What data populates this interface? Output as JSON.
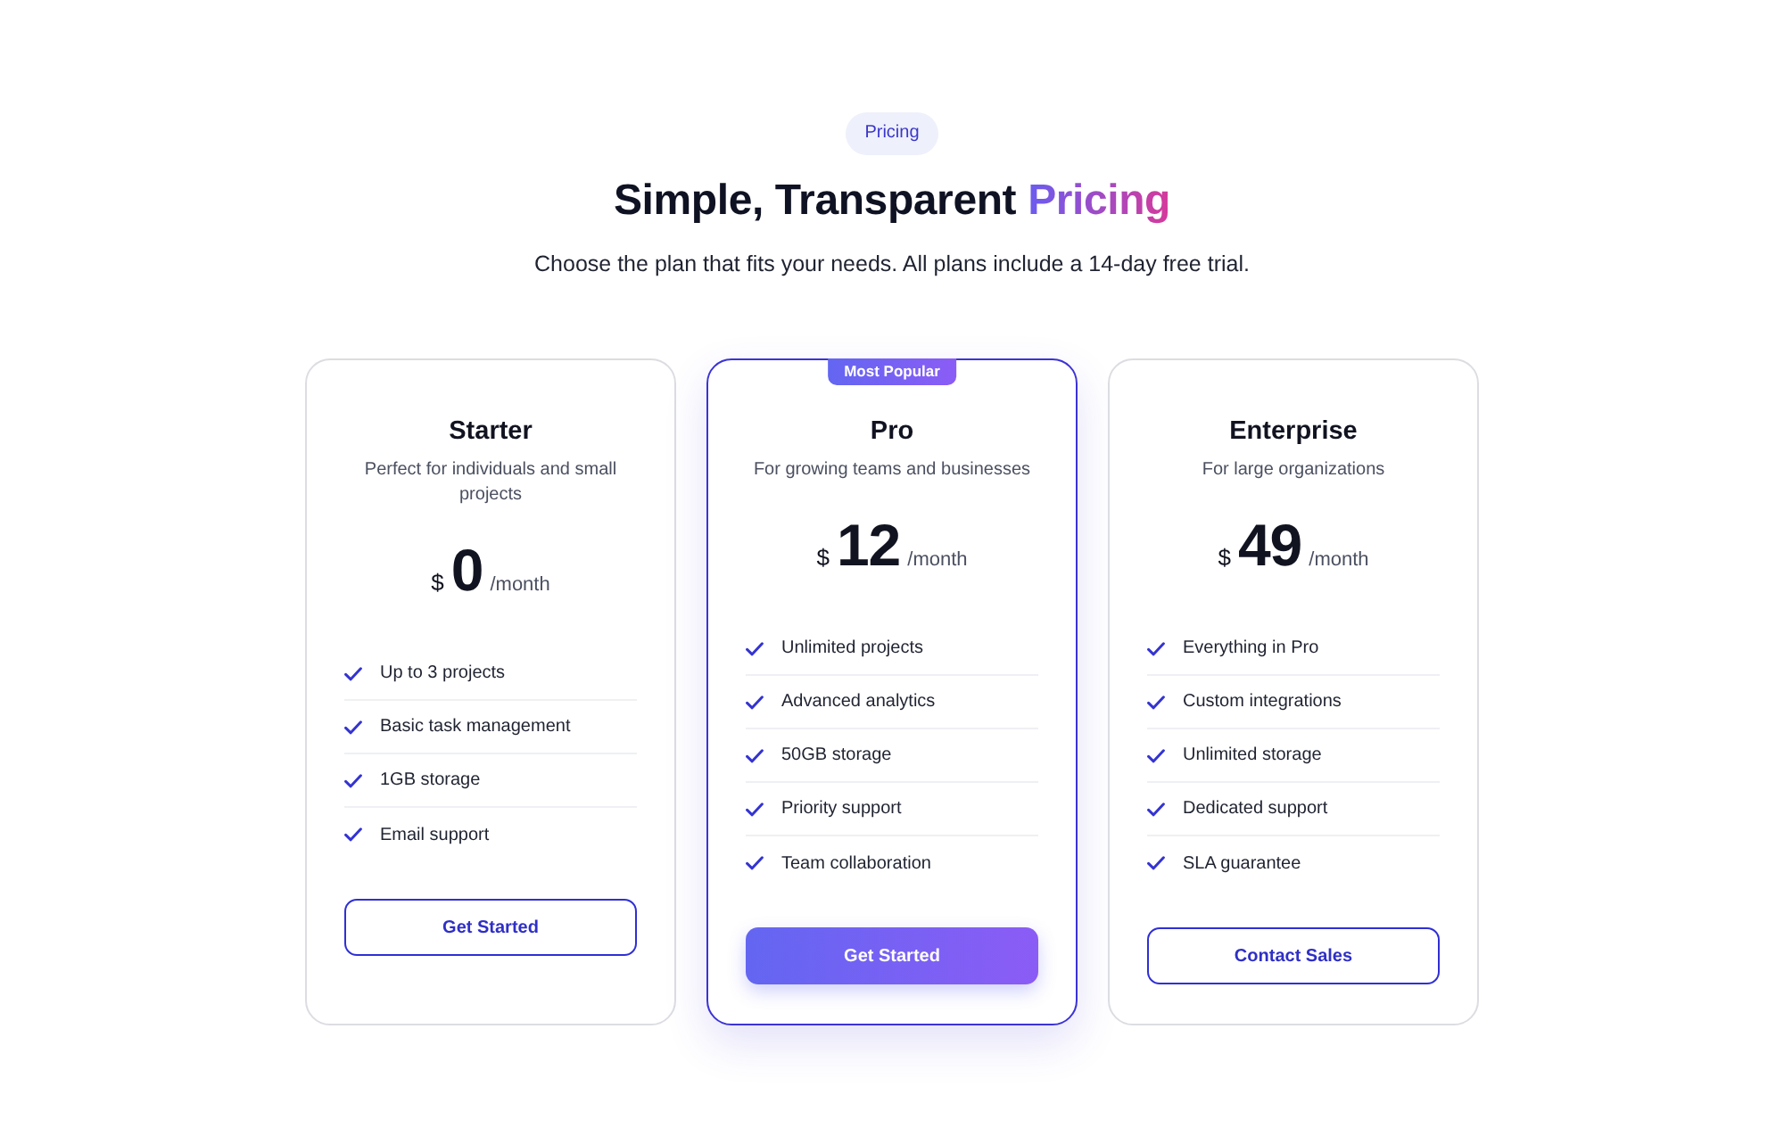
{
  "header": {
    "badge": "Pricing",
    "title": "Simple, Transparent",
    "title_highlight": "Pricing",
    "subtitle": "Choose the plan that fits your needs. All plans include a 14-day free trial."
  },
  "plans": [
    {
      "name": "Starter",
      "description": "Perfect for individuals and small projects",
      "currency": "$",
      "amount": "0",
      "period": "/month",
      "featured": false,
      "features": [
        "Up to 3 projects",
        "Basic task management",
        "1GB storage",
        "Email support"
      ],
      "button": "Get Started"
    },
    {
      "name": "Pro",
      "badge": "Most Popular",
      "description": "For growing teams and businesses",
      "currency": "$",
      "amount": "12",
      "period": "/month",
      "featured": true,
      "features": [
        "Unlimited projects",
        "Advanced analytics",
        "50GB storage",
        "Priority support",
        "Team collaboration"
      ],
      "button": "Get Started"
    },
    {
      "name": "Enterprise",
      "description": "For large organizations",
      "currency": "$",
      "amount": "49",
      "period": "/month",
      "featured": false,
      "features": [
        "Everything in Pro",
        "Custom integrations",
        "Unlimited storage",
        "Dedicated support",
        "SLA guarantee"
      ],
      "button": "Contact Sales"
    }
  ]
}
